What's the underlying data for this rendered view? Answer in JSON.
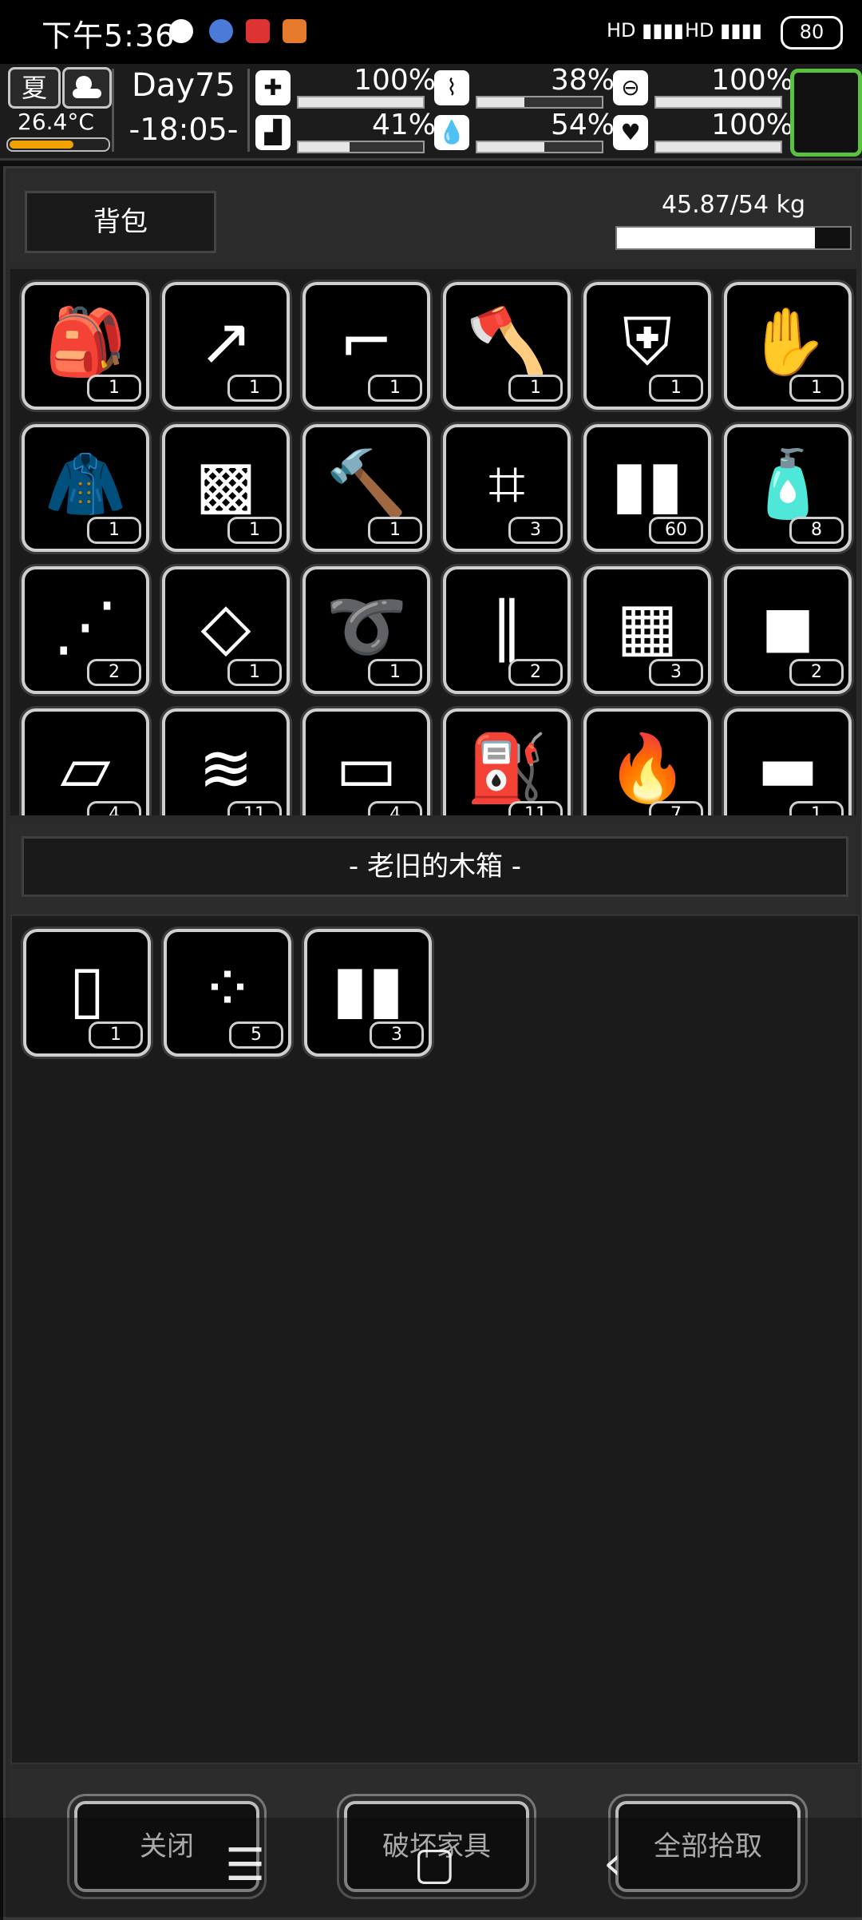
{
  "status_bar": {
    "time": "下午5:36",
    "battery": "80"
  },
  "hud": {
    "season": "夏",
    "temperature": "26.4°C",
    "day": "Day75",
    "clock": "-18:05-",
    "stats": [
      {
        "icon": "health-icon",
        "value": "100%",
        "level": 1.0
      },
      {
        "icon": "stomach-icon",
        "value": "38%",
        "level": 0.38
      },
      {
        "icon": "energy-icon",
        "value": "100%",
        "level": 1.0
      },
      {
        "icon": "foot-icon",
        "value": "41%",
        "level": 0.41
      },
      {
        "icon": "water-icon",
        "value": "54%",
        "level": 0.54
      },
      {
        "icon": "heart-icon",
        "value": "100%",
        "level": 1.0
      }
    ]
  },
  "inventory": {
    "tab_label": "背包",
    "weight_text": "45.87/54 kg",
    "weight_level": 0.85,
    "items": [
      {
        "name": "backpack-icon",
        "count": "1"
      },
      {
        "name": "spear-icon",
        "count": "1"
      },
      {
        "name": "pistol-icon",
        "count": "1"
      },
      {
        "name": "axe-icon",
        "count": "1"
      },
      {
        "name": "shield-icon",
        "count": "1"
      },
      {
        "name": "gloves-icon",
        "count": "1"
      },
      {
        "name": "jacket-icon",
        "count": "1"
      },
      {
        "name": "fur-pack-icon",
        "count": "1"
      },
      {
        "name": "hammer-icon",
        "count": "1"
      },
      {
        "name": "net-icon",
        "count": "3"
      },
      {
        "name": "bullets-icon",
        "count": "60"
      },
      {
        "name": "water-bottle-icon",
        "count": "8"
      },
      {
        "name": "skewer-icon",
        "count": "2"
      },
      {
        "name": "food-tray-icon",
        "count": "1"
      },
      {
        "name": "rope-icon",
        "count": "1"
      },
      {
        "name": "needles-icon",
        "count": "2"
      },
      {
        "name": "trap-net-icon",
        "count": "3"
      },
      {
        "name": "ice-icon",
        "count": "2"
      },
      {
        "name": "paper-icon",
        "count": "4"
      },
      {
        "name": "cloth-icon",
        "count": "11"
      },
      {
        "name": "fabric-icon",
        "count": "4"
      },
      {
        "name": "fuel-can-icon",
        "count": "11"
      },
      {
        "name": "fire-barrel-icon",
        "count": "7"
      },
      {
        "name": "towel-icon",
        "count": "1"
      }
    ]
  },
  "crate": {
    "title": "- 老旧的木箱 -",
    "items": [
      {
        "name": "shell-icon",
        "count": "1"
      },
      {
        "name": "pellets-icon",
        "count": "5"
      },
      {
        "name": "cartridges-icon",
        "count": "3"
      }
    ]
  },
  "footer": {
    "close_label": "关闭",
    "destroy_label": "破坏家具",
    "pickup_all_label": "全部拾取"
  }
}
